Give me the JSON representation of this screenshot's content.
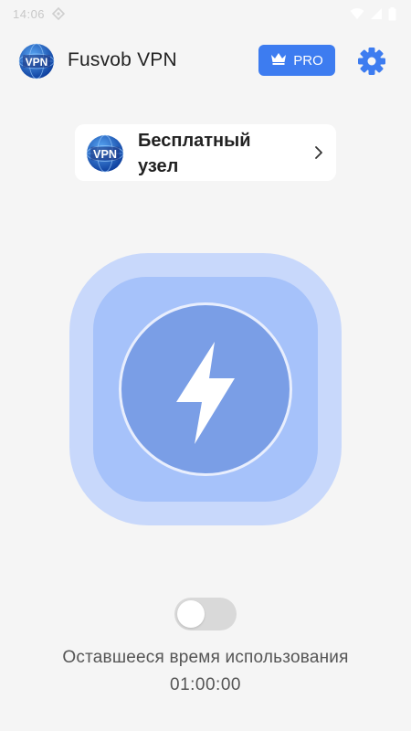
{
  "status_bar": {
    "time": "14:06",
    "icons": [
      "notification-icon",
      "wifi-icon",
      "signal-icon",
      "battery-icon"
    ]
  },
  "header": {
    "logo_text": "VPN",
    "title": "Fusvob VPN",
    "pro_label": "PRO",
    "pro_icon": "crown-icon",
    "settings_icon": "gear-icon"
  },
  "server": {
    "flag_text": "VPN",
    "name": "Бесплатный узел",
    "chevron_icon": "chevron-right-icon"
  },
  "connect": {
    "icon": "lightning-bolt-icon",
    "connected": false
  },
  "usage": {
    "label": "Оставшееся время использования",
    "time": "01:00:00"
  },
  "colors": {
    "accent": "#3d7cf0",
    "background": "#f5f5f5",
    "connect_outer": "#c8d8fb",
    "connect_inner": "#a6c2fa",
    "connect_core": "#7a9ee6",
    "toggle_off": "#d9d9d9"
  }
}
